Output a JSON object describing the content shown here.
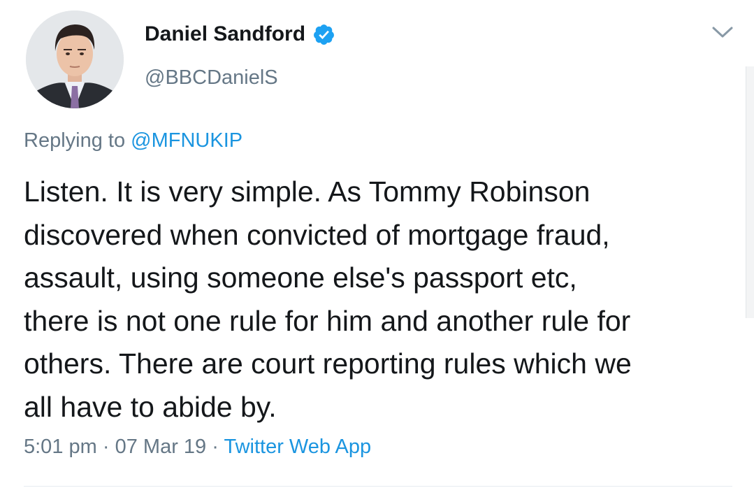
{
  "author": {
    "name": "Daniel Sandford",
    "handle": "@BBCDanielS",
    "verified": true
  },
  "reply": {
    "prefix": "Replying to",
    "mention": "@MFNUKIP"
  },
  "tweet": {
    "text": "Listen. It is very simple. As Tommy Robinson\ndiscovered when convicted of mortgage fraud,\nassault, using someone else's passport etc,\nthere is not one rule for him and another rule for\nothers. There are court reporting rules which we\nall have to abide by."
  },
  "meta": {
    "time": "5:01 pm",
    "separator": "·",
    "date": "07 Mar 19",
    "source": "Twitter Web App"
  },
  "icons": {
    "verified": "verified-badge-icon",
    "menu": "chevron-down-icon"
  },
  "colors": {
    "link": "#1b95e0",
    "secondary_text": "#657786",
    "primary_text": "#14171a"
  }
}
